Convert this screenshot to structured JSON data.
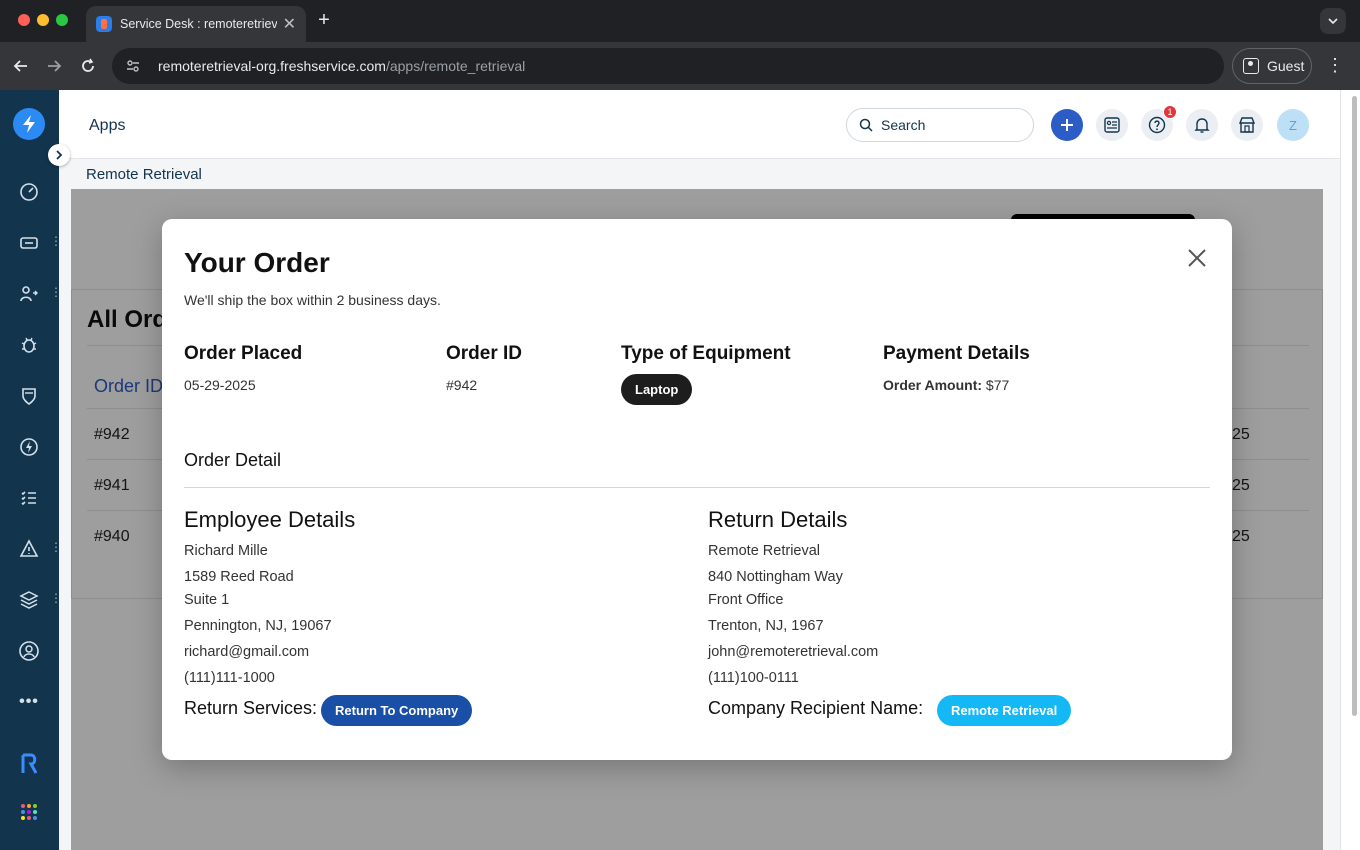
{
  "browser": {
    "tab_title": "Service Desk : remoteretrieva",
    "url_host": "remoteretrieval-org.freshservice.com",
    "url_path": "/apps/remote_retrieval",
    "profile_label": "Guest"
  },
  "header": {
    "title": "Apps",
    "search_placeholder": "Search",
    "notification_count": "1",
    "avatar_initial": "Z"
  },
  "subheader": {
    "title": "Remote Retrieval"
  },
  "background": {
    "card_title": "All Ord",
    "column_label": "Order ID",
    "rows": [
      {
        "id": "#942",
        "tail": "25"
      },
      {
        "id": "#941",
        "tail": "25"
      },
      {
        "id": "#940",
        "tail": "25"
      }
    ]
  },
  "modal": {
    "title": "Your Order",
    "subtitle": "We'll ship the box within 2 business days.",
    "order_placed_label": "Order Placed",
    "order_placed_value": "05-29-2025",
    "order_id_label": "Order ID",
    "order_id_value": "#942",
    "equipment_label": "Type of Equipment",
    "equipment_value": "Laptop",
    "payment_label": "Payment Details",
    "amount_label": "Order Amount:",
    "amount_value": " $77",
    "order_detail_label": "Order Detail",
    "employee": {
      "heading": "Employee Details",
      "name": "Richard Mille",
      "address1": "1589 Reed Road",
      "address2": "Suite 1",
      "city": "Pennington, NJ, 19067",
      "email": "richard@gmail.com",
      "phone": "(111)111-1000",
      "service_label": "Return Services:",
      "service_value": "Return To Company"
    },
    "return": {
      "heading": "Return Details",
      "name": "Remote Retrieval",
      "address1": "840 Nottingham Way",
      "address2": "Front Office",
      "city": "Trenton, NJ, 1967",
      "email": "john@remoteretrieval.com",
      "phone": "(111)100-0111",
      "recipient_label": "Company Recipient Name:",
      "recipient_value": "Remote Retrieval"
    }
  }
}
